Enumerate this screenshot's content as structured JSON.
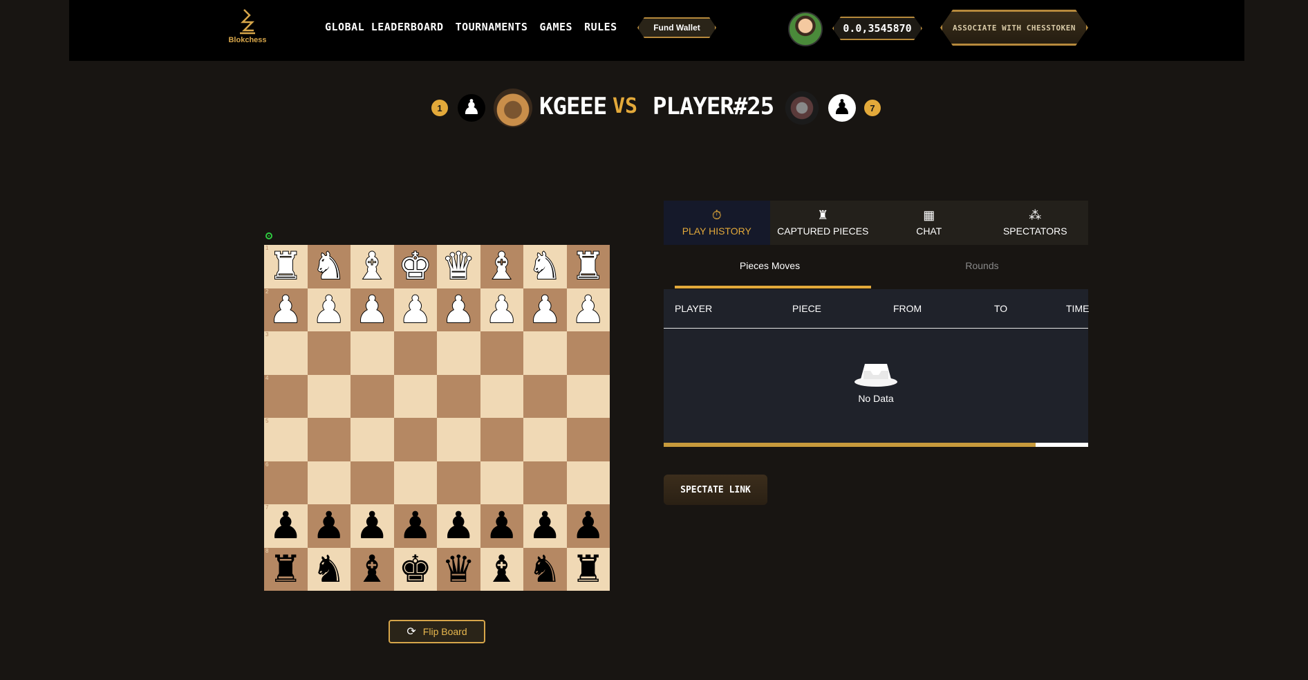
{
  "nav": {
    "logo_text": "Blokchess",
    "menu": [
      "GLOBAL LEADERBOARD",
      "TOURNAMENTS",
      "GAMES",
      "RULES"
    ],
    "fund_wallet": "Fund Wallet",
    "balance": "0.0,3545870",
    "associate": "ASSOCIATE WITH CHESSTOKEN"
  },
  "match": {
    "player1": {
      "rank": "1",
      "name": "KGEEE",
      "piece": "♟"
    },
    "vs": "VS",
    "player2": {
      "rank": "7",
      "name": "PLAYER#25",
      "piece": "♟"
    }
  },
  "board": {
    "rank_labels": [
      "1",
      "2",
      "3",
      "4",
      "5",
      "6",
      "7",
      "8"
    ],
    "rows": [
      [
        "♜",
        "♞",
        "♝",
        "♚",
        "♛",
        "♝",
        "♞",
        "♜"
      ],
      [
        "♟",
        "♟",
        "♟",
        "♟",
        "♟",
        "♟",
        "♟",
        "♟"
      ],
      [
        "",
        "",
        "",
        "",
        "",
        "",
        "",
        ""
      ],
      [
        "",
        "",
        "",
        "",
        "",
        "",
        "",
        ""
      ],
      [
        "",
        "",
        "",
        "",
        "",
        "",
        "",
        ""
      ],
      [
        "",
        "",
        "",
        "",
        "",
        "",
        "",
        ""
      ],
      [
        "♟",
        "♟",
        "♟",
        "♟",
        "♟",
        "♟",
        "♟",
        "♟"
      ],
      [
        "♜",
        "♞",
        "♝",
        "♚",
        "♛",
        "♝",
        "♞",
        "♜"
      ]
    ],
    "row_colors": [
      "white",
      "white",
      "",
      "",
      "",
      "",
      "black",
      "black"
    ],
    "flip_label": "Flip Board"
  },
  "panel": {
    "tabs": [
      {
        "label": "PLAY HISTORY",
        "icon": "⏱"
      },
      {
        "label": "CAPTURED PIECES",
        "icon": "♜"
      },
      {
        "label": "CHAT",
        "icon": "▦"
      },
      {
        "label": "SPECTATORS",
        "icon": "⁂"
      }
    ],
    "subtabs": [
      "Pieces Moves",
      "Rounds"
    ],
    "columns": [
      "PLAYER",
      "PIECE",
      "FROM",
      "TO",
      "TIME"
    ],
    "empty_text": "No Data",
    "spectate": "SPECTATE LINK"
  },
  "colors": {
    "accent": "#e3a93a",
    "light_square": "#f0d9b5",
    "dark_square": "#b58863"
  }
}
